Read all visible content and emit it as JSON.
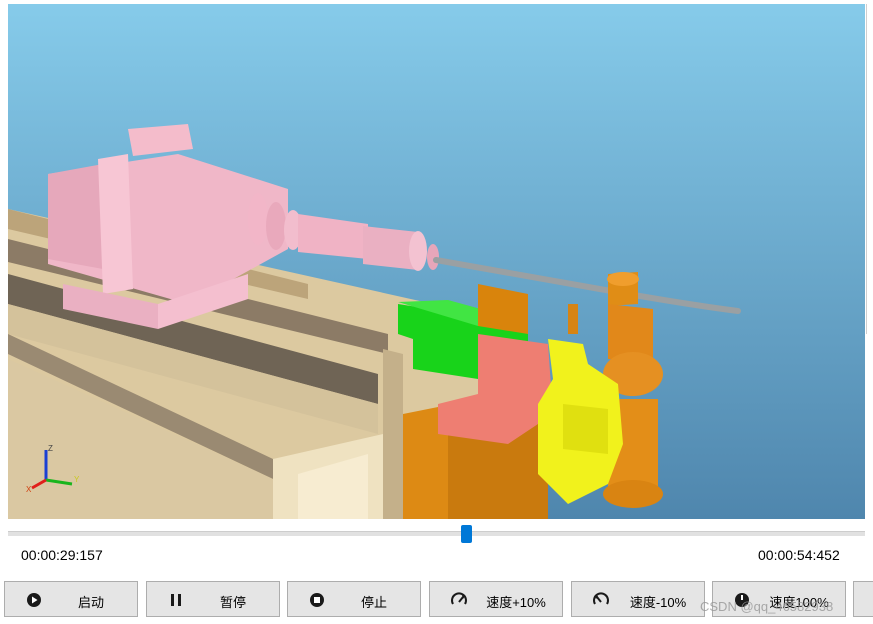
{
  "simulation": {
    "view": "3d-pipe-bending-machine",
    "axes_labels": {
      "x": "X",
      "y": "Y",
      "z": "Z"
    }
  },
  "playback": {
    "current_time": "00:00:29:157",
    "total_time": "00:00:54:452",
    "progress_fraction": 0.535
  },
  "controls": [
    {
      "label": "启动",
      "icon": "play-icon"
    },
    {
      "label": "暂停",
      "icon": "pause-icon"
    },
    {
      "label": "停止",
      "icon": "stop-icon"
    },
    {
      "label": "速度+10%",
      "icon": "speed-up-icon"
    },
    {
      "label": "速度-10%",
      "icon": "speed-down-icon"
    },
    {
      "label": "速度100%",
      "icon": "speed-reset-icon"
    }
  ],
  "watermark": "CSDN @qq_46582938",
  "colors": {
    "sky_top": "#86cbea",
    "sky_bottom": "#4f86ad",
    "accent": "#0078d7"
  }
}
